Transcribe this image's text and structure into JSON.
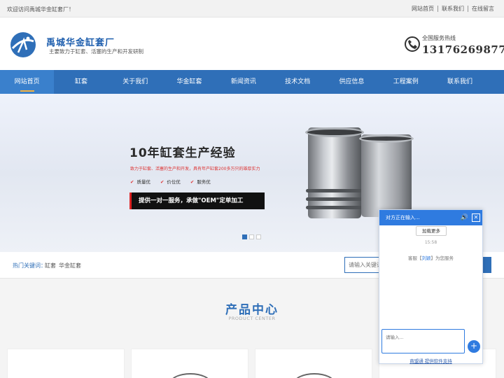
{
  "topbar": {
    "welcome": "欢迎访问禹城华金缸套厂！",
    "links": [
      "网站首页",
      "联系我们",
      "在线留言"
    ]
  },
  "header": {
    "company_name": "禹城华金缸套厂",
    "slogan": "主要致力于缸套、活塞的生产和开发研制",
    "hotline_label": "全国服务热线",
    "hotline_number": "13176269877"
  },
  "nav": {
    "items": [
      "网站首页",
      "缸套",
      "关于我们",
      "华金缸套",
      "新闻资讯",
      "技术文档",
      "供应信息",
      "工程案例",
      "联系我们"
    ],
    "active_index": 0
  },
  "banner": {
    "title": "10年缸套生产经验",
    "subtitle": "致力于缸套、活塞的生产和开发，具有年产缸套200多万只的雄厚实力",
    "features": [
      "质量优",
      "价位优",
      "服务优"
    ],
    "promo": "提供一对一服务，承做\"OEM\"定单加工",
    "slides": 3,
    "active_slide": 0
  },
  "search": {
    "hot_label": "热门关键词：",
    "keywords": [
      "缸套",
      "华金缸套"
    ],
    "placeholder": "请输入关键词",
    "button_label": "搜索"
  },
  "products": {
    "title": "产品中心",
    "subtitle": "PRODUCT CENTER"
  },
  "chat": {
    "header": "对方正在输入...",
    "load_more": "加载更多",
    "time": "15:58",
    "msg_prefix": "客服【",
    "agent": "刘颖",
    "msg_suffix": "】为您服务",
    "input_placeholder": "请输入...",
    "send_label": "+",
    "footer": "商盟通 提供软件支持"
  },
  "colors": {
    "primary": "#2f6fb8",
    "chat_blue": "#2f7be0",
    "accent_red": "#d33333"
  }
}
